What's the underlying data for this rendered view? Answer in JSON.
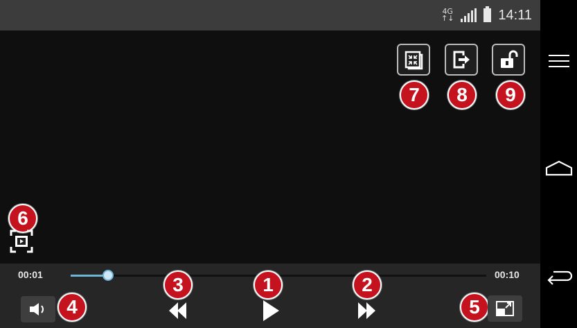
{
  "status_bar": {
    "network": "4G",
    "time": "14:11",
    "icons": [
      "4g-icon",
      "signal-icon",
      "battery-icon"
    ]
  },
  "player": {
    "elapsed": "00:01",
    "duration": "00:10",
    "progress_fraction": 0.09,
    "top_controls": [
      {
        "name": "fit-screen-button",
        "icon": "fit-screen-icon",
        "badge": "7"
      },
      {
        "name": "exit-button",
        "icon": "exit-icon",
        "badge": "8"
      },
      {
        "name": "lock-button",
        "icon": "unlock-icon",
        "badge": "9"
      }
    ],
    "capture_badge": "6",
    "badges": {
      "play": "1",
      "forward": "2",
      "rewind": "3",
      "volume": "4",
      "popup": "5"
    }
  },
  "colors": {
    "badge": "#c4121f",
    "progress": "#6fb5d8",
    "screen": "#0f0f10"
  },
  "nav_bar": {
    "icons": [
      "menu-icon",
      "home-icon",
      "back-icon"
    ]
  }
}
